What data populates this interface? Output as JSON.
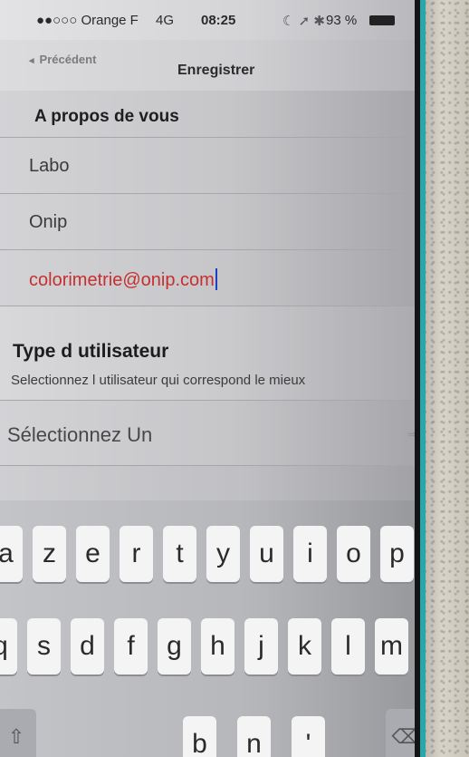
{
  "status_bar": {
    "carrier": "●●○○○ Orange F",
    "network": "4G",
    "time": "08:25",
    "icons": "☾ ➚ ✱",
    "battery": "93 %"
  },
  "nav": {
    "back_label": "Précédent",
    "title": "Enregistrer"
  },
  "about": {
    "header": "A propos de vous",
    "fields": [
      {
        "value": "Labo"
      },
      {
        "value": "Onip"
      },
      {
        "value": "colorimetrie@onip.com"
      }
    ]
  },
  "user_type": {
    "title": "Type d utilisateur",
    "subtitle": "Selectionnez l utilisateur qui correspond le mieux",
    "select_value": "Sélectionnez Un"
  },
  "keyboard": {
    "row1": [
      "a",
      "z",
      "e",
      "r",
      "t",
      "y",
      "u",
      "i",
      "o",
      "p"
    ],
    "row2": [
      "q",
      "s",
      "d",
      "f",
      "g",
      "h",
      "j",
      "k",
      "l",
      "m"
    ],
    "row3_partial": [
      "b",
      "n",
      "'"
    ]
  },
  "colors": {
    "email_text": "#c62f2f",
    "cursor": "#1a3fc8",
    "case_accent": "#2aa6a8"
  }
}
